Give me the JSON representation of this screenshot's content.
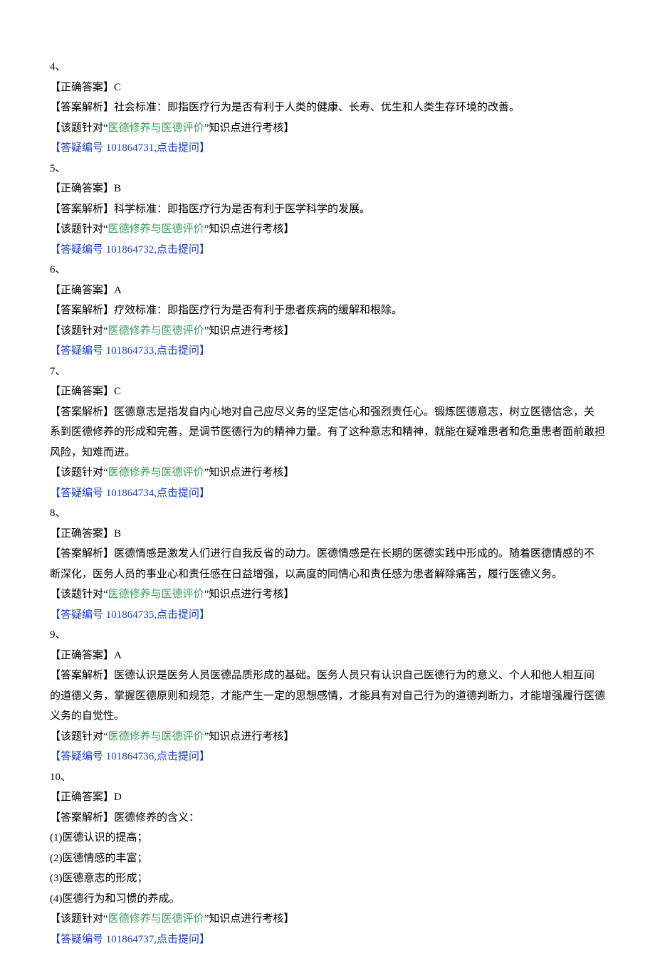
{
  "topic_label_prefix": "【该题针对“",
  "topic_label_suffix": "”知识点进行考核】",
  "topic_name": "医德修养与医德评价",
  "correct_answer_prefix": "【正确答案】",
  "analysis_prefix": "【答案解析】",
  "qa_prefix": "【答疑编号 ",
  "qa_mid": ",",
  "qa_action": "点击提问",
  "qa_suffix": "】",
  "items": [
    {
      "num": "4、",
      "answer": "C",
      "analysis": "社会标准：即指医疗行为是否有利于人类的健康、长寿、优生和人类生存环境的改善。",
      "qid": "101864731"
    },
    {
      "num": "5、",
      "answer": "B",
      "analysis": "科学标准：即指医疗行为是否有利于医学科学的发展。",
      "qid": "101864732"
    },
    {
      "num": "6、",
      "answer": "A",
      "analysis": "疗效标准：即指医疗行为是否有利于患者疾病的缓解和根除。",
      "qid": "101864733"
    },
    {
      "num": "7、",
      "answer": "C",
      "analysis": "医德意志是指发自内心地对自己应尽义务的坚定信心和强烈责任心。锻炼医德意志，树立医德信念，关系到医德修养的形成和完善，是调节医德行为的精神力量。有了这种意志和精神，就能在疑难患者和危重患者面前敢担风险，知难而进。",
      "qid": "101864734"
    },
    {
      "num": "8、",
      "answer": "B",
      "analysis": "医德情感是激发人们进行自我反省的动力。医德情感是在长期的医德实践中形成的。随着医德情感的不断深化，医务人员的事业心和责任感在日益增强，以高度的同情心和责任感为患者解除痛苦，履行医德义务。",
      "qid": "101864735"
    },
    {
      "num": "9、",
      "answer": "A",
      "analysis": "医德认识是医务人员医德品质形成的基础。医务人员只有认识自己医德行为的意义、个人和他人相互间的道德义务，掌握医德原则和规范，才能产生一定的思想感情，才能具有对自己行为的道德判断力，才能增强履行医德义务的自觉性。",
      "qid": "101864736"
    },
    {
      "num": "10、",
      "answer": "D",
      "analysis": "医德修养的含义：",
      "sublist": [
        "(1)医德认识的提高；",
        "(2)医德情感的丰富；",
        "(3)医德意志的形成；",
        "(4)医德行为和习惯的养成。"
      ],
      "qid": "101864737"
    }
  ]
}
